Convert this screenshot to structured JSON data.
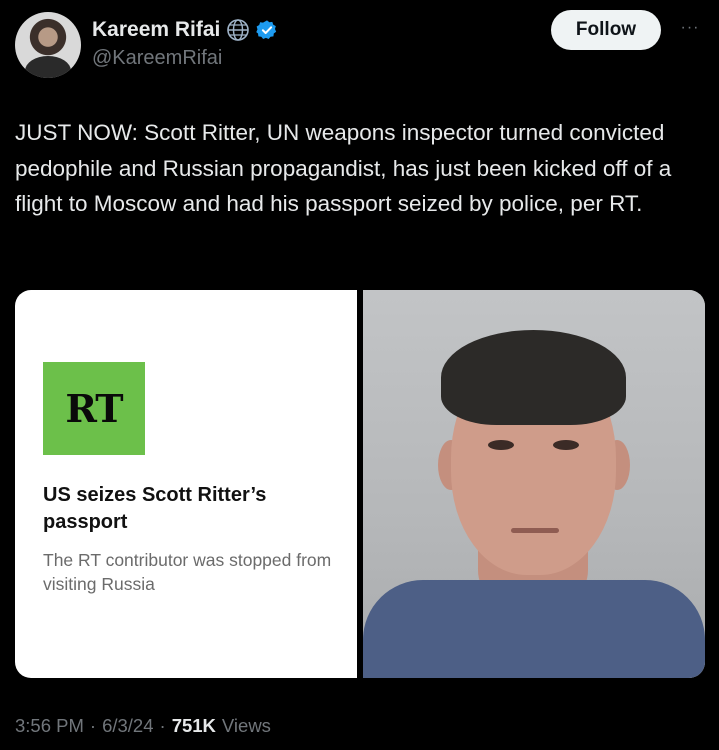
{
  "author": {
    "display_name": "Kareem Rifai",
    "handle": "@KareemRifai",
    "badges": [
      "globe-icon",
      "verified-badge-icon"
    ],
    "verified_color": "#1d9bf0"
  },
  "actions": {
    "follow_label": "Follow",
    "more_label": "···"
  },
  "tweet": {
    "text": "JUST NOW: Scott Ritter, UN weapons inspector turned convicted pedophile and Russian propagandist, has just been kicked off of a flight to Moscow and had his passport seized by police, per RT."
  },
  "media": {
    "card": {
      "logo_text": "RT",
      "logo_color": "#6cc04a",
      "headline": "US seizes Scott Ritter’s passport",
      "subtitle": "The RT contributor was stopped from visiting Russia"
    },
    "photo": {
      "icon": "mugshot-photo"
    }
  },
  "meta": {
    "time": "3:56 PM",
    "sep1": "·",
    "date": "6/3/24",
    "sep2": "·",
    "views_count": "751K",
    "views_label": "Views"
  }
}
